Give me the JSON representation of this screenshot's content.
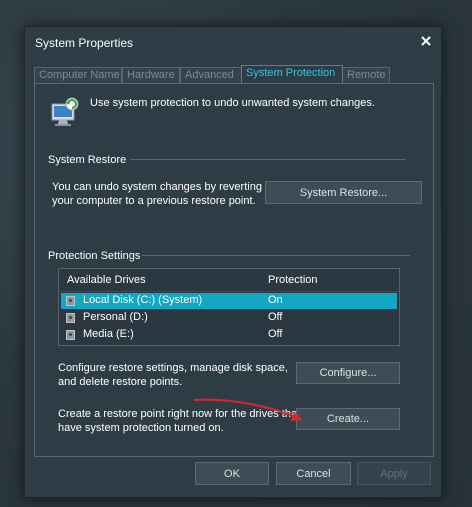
{
  "window": {
    "title": "System Properties"
  },
  "tabs": [
    {
      "label": "Computer Name"
    },
    {
      "label": "Hardware"
    },
    {
      "label": "Advanced"
    },
    {
      "label": "System Protection"
    },
    {
      "label": "Remote"
    }
  ],
  "intro_text": "Use system protection to undo unwanted system changes.",
  "system_restore": {
    "heading": "System Restore",
    "description_line1": "You can undo system changes by reverting",
    "description_line2": "your computer to a previous restore point.",
    "button_label": "System Restore..."
  },
  "protection_settings": {
    "heading": "Protection Settings",
    "columns": [
      "Available Drives",
      "Protection"
    ],
    "drives": [
      {
        "name": "Local Disk (C:) (System)",
        "protection": "On",
        "selected": true
      },
      {
        "name": "Personal (D:)",
        "protection": "Off",
        "selected": false
      },
      {
        "name": "Media (E:)",
        "protection": "Off",
        "selected": false
      }
    ],
    "configure_text_line1": "Configure restore settings, manage disk space,",
    "configure_text_line2": "and delete restore points.",
    "configure_button": "Configure...",
    "create_text_line1": "Create a restore point right now for the drives that",
    "create_text_line2": "have system protection turned on.",
    "create_button": "Create..."
  },
  "footer": {
    "ok": "OK",
    "cancel": "Cancel",
    "apply": "Apply"
  },
  "colors": {
    "accent": "#12a7c2",
    "active_tab": "#37c4e3",
    "annotation_arrow": "#d9262b"
  },
  "icons": [
    "close-icon",
    "system-protection-icon",
    "drive-icon",
    "annotation-arrow"
  ]
}
